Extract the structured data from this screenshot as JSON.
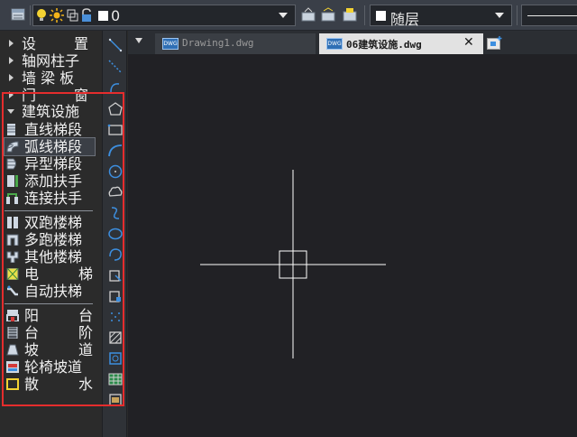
{
  "toolbar": {
    "layer_value": "0",
    "layer_right_value": "随层",
    "icons": [
      "layer-manager-icon",
      "lightbulb-icon",
      "sun-freeze-icon",
      "layer-color-icon",
      "lock-icon",
      "match-layer-icon",
      "layer-previous-icon",
      "layer-isolate-icon"
    ]
  },
  "sidebar": {
    "categories": [
      {
        "label_a": "设",
        "label_b": "置",
        "expanded": false
      },
      {
        "label": "轴网柱子",
        "expanded": false
      },
      {
        "label": "墙 梁 板",
        "expanded": false
      },
      {
        "label_a": "门",
        "label_b": "窗",
        "expanded": false
      },
      {
        "label": "建筑设施",
        "expanded": true
      }
    ],
    "group1": [
      {
        "label": "直线梯段",
        "icon": "straight-stair-icon"
      },
      {
        "label": "弧线梯段",
        "icon": "arc-stair-icon",
        "selected": true
      },
      {
        "label": "异型梯段",
        "icon": "custom-stair-icon"
      },
      {
        "label": "添加扶手",
        "icon": "add-handrail-icon"
      },
      {
        "label": "连接扶手",
        "icon": "connect-handrail-icon"
      }
    ],
    "group2": [
      {
        "label": "双跑楼梯",
        "icon": "double-run-stair-icon"
      },
      {
        "label": "多跑楼梯",
        "icon": "multi-run-stair-icon"
      },
      {
        "label": "其他楼梯",
        "icon": "other-stair-icon"
      },
      {
        "label_a": "电",
        "label_b": "梯",
        "icon": "elevator-icon"
      },
      {
        "label": "自动扶梯",
        "icon": "escalator-icon"
      }
    ],
    "group3": [
      {
        "label_a": "阳",
        "label_b": "台",
        "icon": "balcony-icon"
      },
      {
        "label_a": "台",
        "label_b": "阶",
        "icon": "steps-icon"
      },
      {
        "label_a": "坡",
        "label_b": "道",
        "icon": "ramp-icon"
      },
      {
        "label": "轮椅坡道",
        "icon": "wheelchair-ramp-icon"
      },
      {
        "label_a": "散",
        "label_b": "水",
        "icon": "apron-icon"
      }
    ]
  },
  "tabs": [
    {
      "label": "Drawing1.dwg",
      "active": false
    },
    {
      "label": "06建筑设施.dwg",
      "active": true
    }
  ],
  "tab_close": "✕",
  "dwg_badge": "DWG",
  "colors": {
    "highlight_box": "#e52d2d",
    "canvas_bg": "#212125",
    "panel_bg": "#2b2b2b",
    "accent_blue": "#3d8fe0"
  }
}
